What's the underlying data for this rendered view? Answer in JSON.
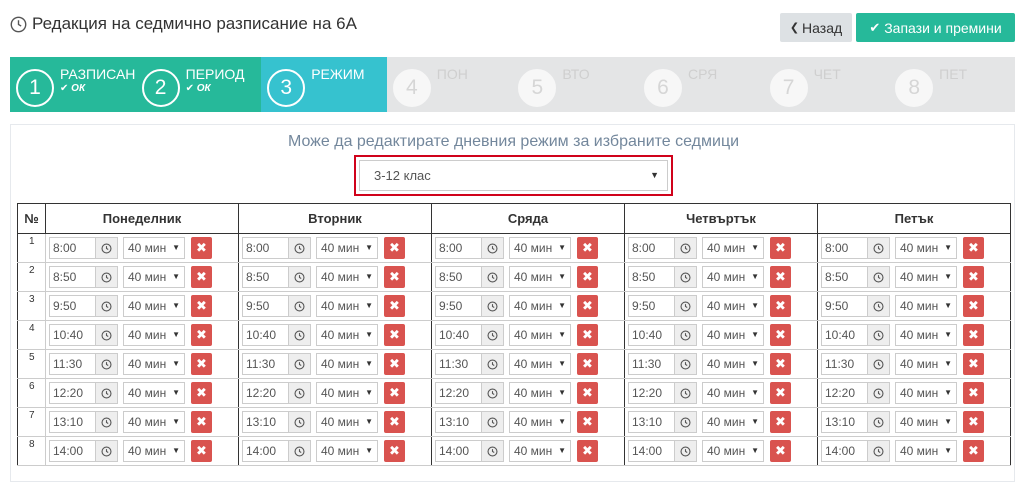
{
  "page": {
    "title": "Редакция на седмично разписание на 6А",
    "back_label": "Назад",
    "save_label": "Запази и премини"
  },
  "wizard": {
    "steps": [
      {
        "num": "1",
        "label": "РАЗПИСАН",
        "status": "ОК",
        "state": "done"
      },
      {
        "num": "2",
        "label": "ПЕРИОД",
        "status": "ОК",
        "state": "done"
      },
      {
        "num": "3",
        "label": "РЕЖИМ",
        "status": "",
        "state": "active"
      },
      {
        "num": "4",
        "label": "ПОН",
        "status": "",
        "state": "pending"
      },
      {
        "num": "5",
        "label": "ВТО",
        "status": "",
        "state": "pending"
      },
      {
        "num": "6",
        "label": "СРЯ",
        "status": "",
        "state": "pending"
      },
      {
        "num": "7",
        "label": "ЧЕТ",
        "status": "",
        "state": "pending"
      },
      {
        "num": "8",
        "label": "ПЕТ",
        "status": "",
        "state": "pending"
      }
    ]
  },
  "panel": {
    "instruction": "Може да редактирате дневния режим за избраните седмици",
    "class_select": "3-12 клас"
  },
  "table": {
    "no_header": "№",
    "days": [
      "Понеделник",
      "Вторник",
      "Сряда",
      "Четвъртък",
      "Петък"
    ],
    "rows": [
      {
        "no": "1",
        "time": "8:00",
        "duration": "40 мин"
      },
      {
        "no": "2",
        "time": "8:50",
        "duration": "40 мин"
      },
      {
        "no": "3",
        "time": "9:50",
        "duration": "40 мин"
      },
      {
        "no": "4",
        "time": "10:40",
        "duration": "40 мин"
      },
      {
        "no": "5",
        "time": "11:30",
        "duration": "40 мин"
      },
      {
        "no": "6",
        "time": "12:20",
        "duration": "40 мин"
      },
      {
        "no": "7",
        "time": "13:10",
        "duration": "40 мин"
      },
      {
        "no": "8",
        "time": "14:00",
        "duration": "40 мин"
      }
    ]
  },
  "colors": {
    "done": "#26b99a",
    "active": "#36c2cf",
    "pending": "#e4e5e6",
    "delete": "#d9534f",
    "highlight": "#d0021b"
  },
  "icons": {
    "title": "clock-icon",
    "back": "chevron-left-icon",
    "save": "check-icon",
    "step_ok": "check-icon",
    "time": "clock-icon",
    "select": "caret-down-icon",
    "delete": "close-icon"
  }
}
